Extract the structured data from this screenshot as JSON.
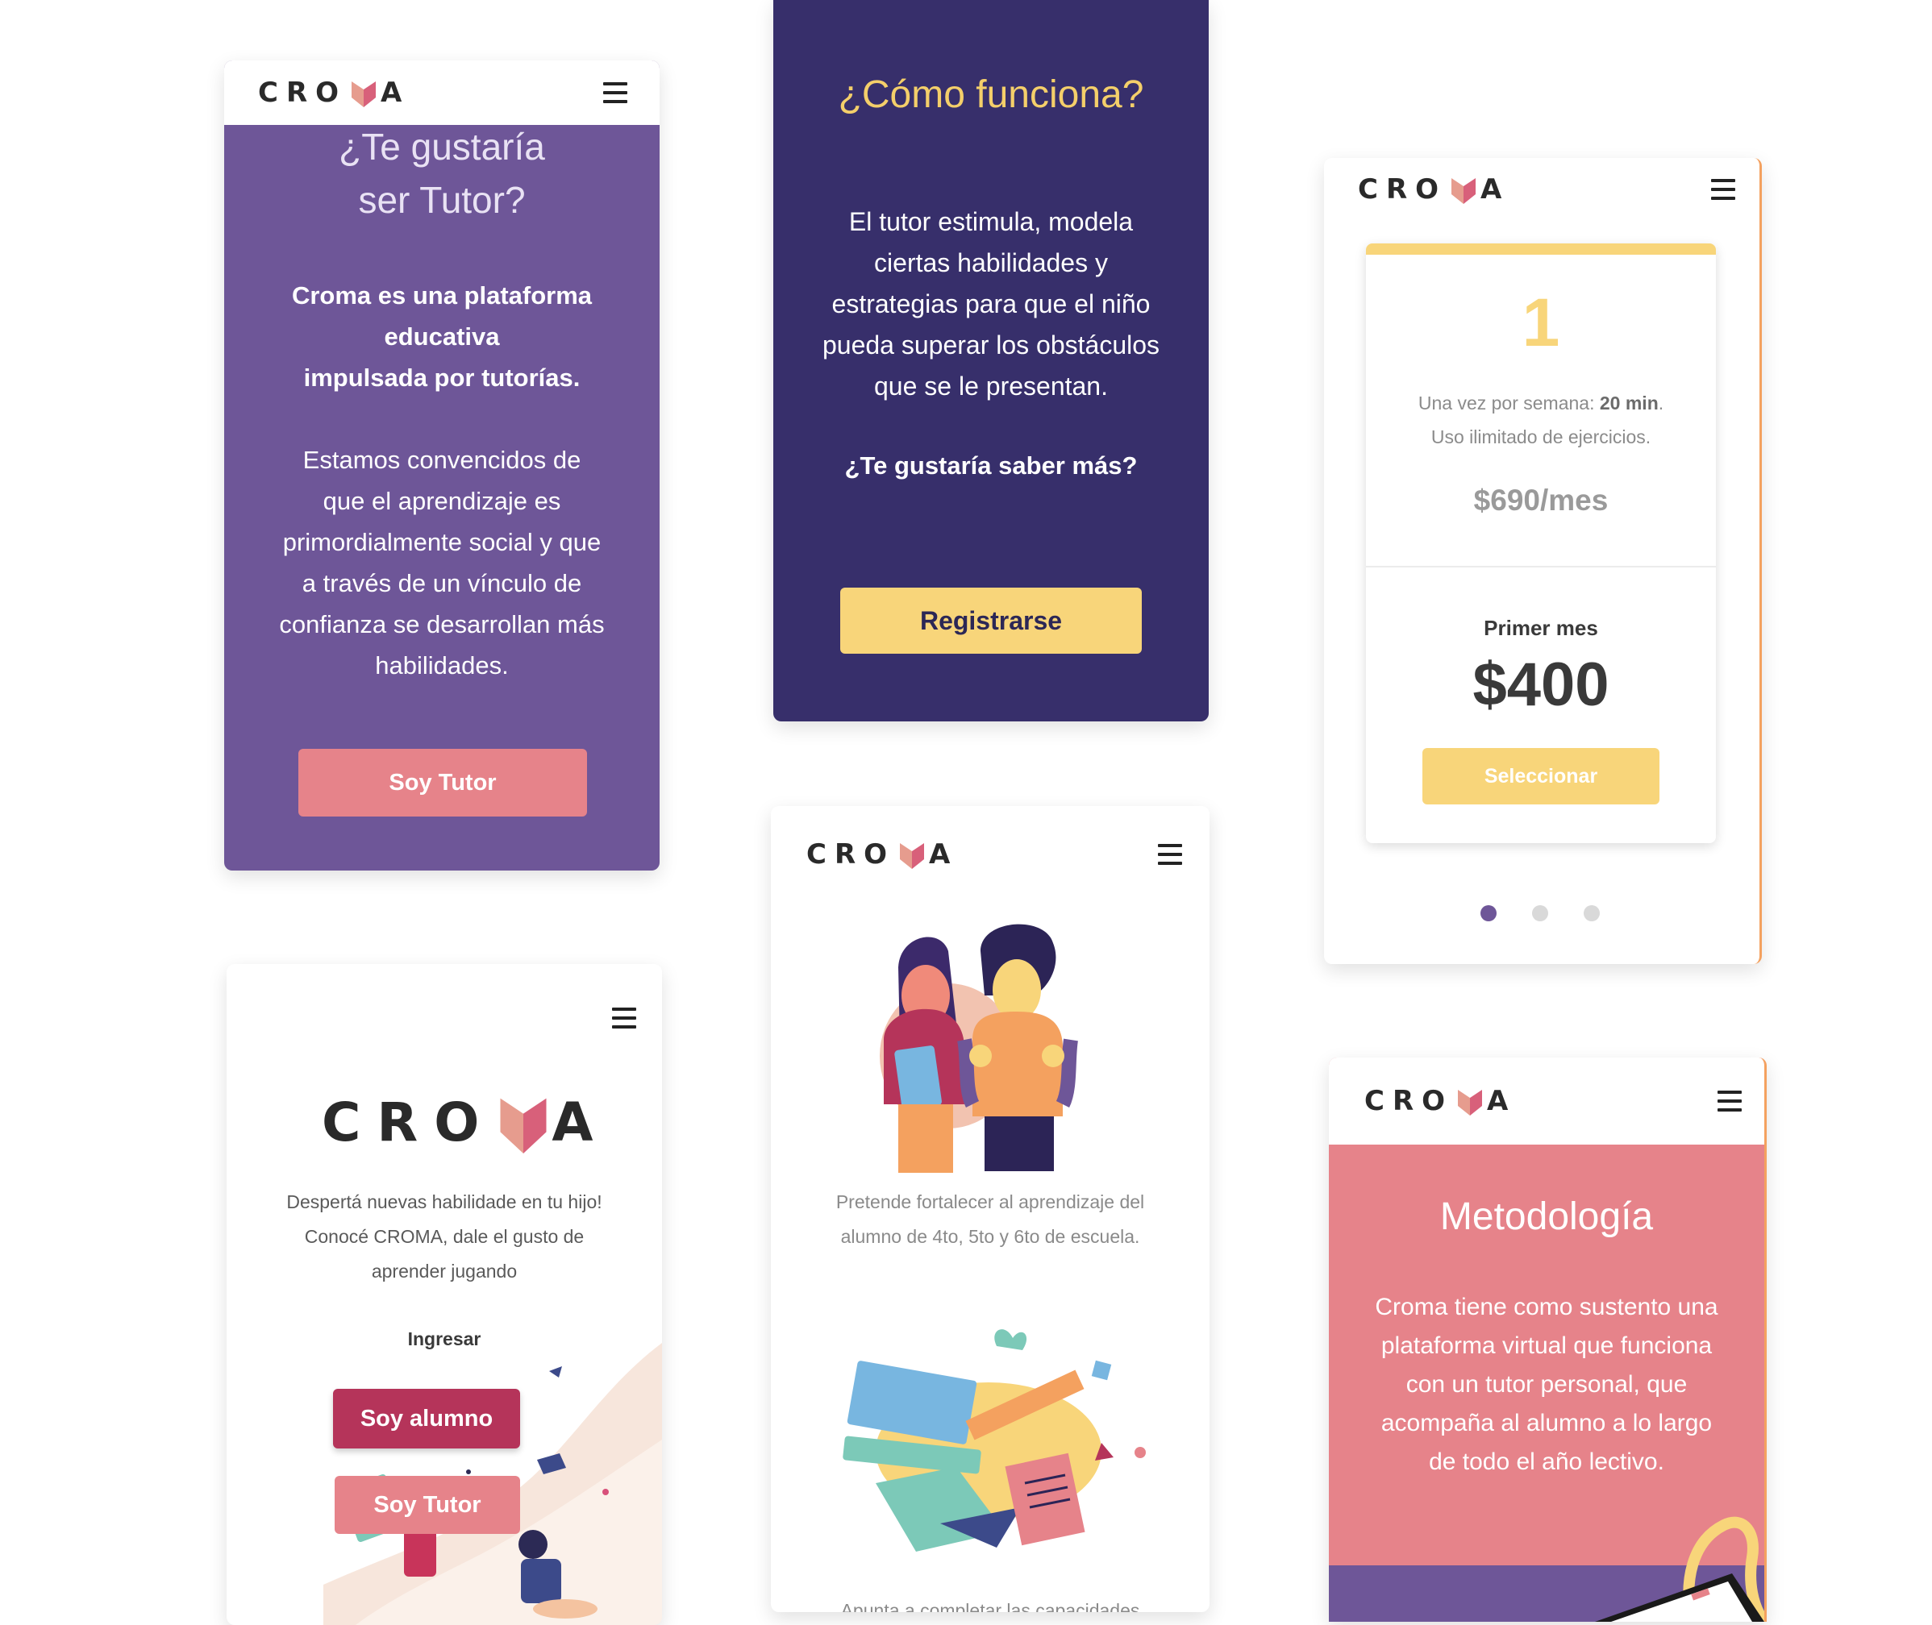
{
  "colors": {
    "purple": "#6e5698",
    "navy": "#372f6b",
    "yellow": "#f8d57a",
    "pink": "#e6838a",
    "dark_pink": "#b5345a",
    "logo_pink": "#e07e80"
  },
  "brand": {
    "logo_left": "CRO",
    "logo_right": "A"
  },
  "card_tutor": {
    "title_line1": "¿Te gustaría",
    "title_line2": "ser Tutor?",
    "bold_line1": "Croma es una plataforma",
    "bold_line2": "educativa",
    "bold_line3": "impulsada por tutorías.",
    "body_line1": "Estamos  convencidos de",
    "body_line2": "que el aprendizaje es",
    "body_line3": "primordialmente social y que",
    "body_line4": "a través de un vínculo de",
    "body_line5": "confianza se desarrollan más",
    "body_line6": "habilidades.",
    "button": "Soy Tutor"
  },
  "card_como": {
    "title": "¿Cómo funciona?",
    "body_line1": "El tutor estimula, modela",
    "body_line2": "ciertas habilidades y",
    "body_line3": "estrategias para que el niño",
    "body_line4": "pueda superar los obstáculos",
    "body_line5": "que se le presentan.",
    "question": "¿Te gustaría saber más?",
    "button": "Registrarse"
  },
  "card_pricing": {
    "number": "1",
    "line1_prefix": "Una vez por semana:  ",
    "line1_bold": "20 min",
    "line1_suffix": ".",
    "line2": "Uso ilimitado  de ejercicios.",
    "price_month": "$690/mes",
    "first_month_label": "Primer mes",
    "first_month_price": "$400",
    "button": "Seleccionar",
    "carousel_active_index": 0,
    "carousel_count": 3
  },
  "card_home": {
    "tagline1": "Despertá nuevas habilidade en tu hijo!",
    "tagline2": "Conocé CROMA, dale el gusto de",
    "tagline3": "aprender jugando",
    "login": "Ingresar",
    "btn_student": "Soy alumno",
    "btn_tutor": "Soy Tutor"
  },
  "card_students": {
    "caption1": "Pretende fortalecer al aprendizaje del",
    "caption2": "alumno  de 4to, 5to y 6to de escuela.",
    "caption3": "Apunta a completar las capacidades"
  },
  "card_metodo": {
    "title": "Metodología",
    "body_line1": "Croma tiene como sustento una",
    "body_line2": "plataforma virtual que funciona",
    "body_line3": "con un tutor personal, que",
    "body_line4": "acompaña al alumno a lo largo",
    "body_line5": "de todo el año lectivo."
  }
}
